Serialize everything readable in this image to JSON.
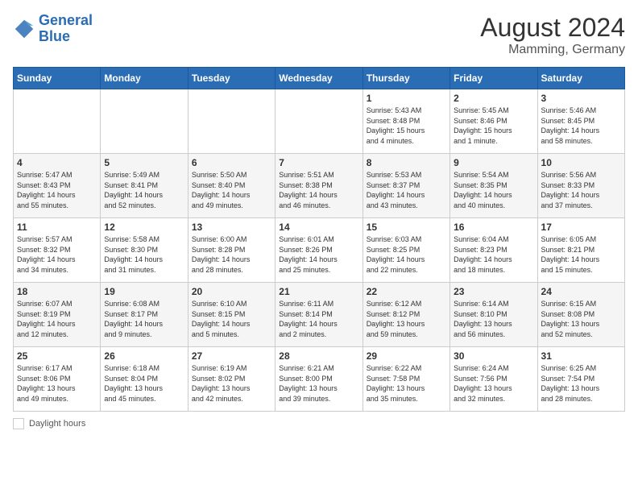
{
  "header": {
    "logo_line1": "General",
    "logo_line2": "Blue",
    "month_year": "August 2024",
    "location": "Mamming, Germany"
  },
  "weekdays": [
    "Sunday",
    "Monday",
    "Tuesday",
    "Wednesday",
    "Thursday",
    "Friday",
    "Saturday"
  ],
  "weeks": [
    [
      {
        "day": "",
        "info": ""
      },
      {
        "day": "",
        "info": ""
      },
      {
        "day": "",
        "info": ""
      },
      {
        "day": "",
        "info": ""
      },
      {
        "day": "1",
        "info": "Sunrise: 5:43 AM\nSunset: 8:48 PM\nDaylight: 15 hours\nand 4 minutes."
      },
      {
        "day": "2",
        "info": "Sunrise: 5:45 AM\nSunset: 8:46 PM\nDaylight: 15 hours\nand 1 minute."
      },
      {
        "day": "3",
        "info": "Sunrise: 5:46 AM\nSunset: 8:45 PM\nDaylight: 14 hours\nand 58 minutes."
      }
    ],
    [
      {
        "day": "4",
        "info": "Sunrise: 5:47 AM\nSunset: 8:43 PM\nDaylight: 14 hours\nand 55 minutes."
      },
      {
        "day": "5",
        "info": "Sunrise: 5:49 AM\nSunset: 8:41 PM\nDaylight: 14 hours\nand 52 minutes."
      },
      {
        "day": "6",
        "info": "Sunrise: 5:50 AM\nSunset: 8:40 PM\nDaylight: 14 hours\nand 49 minutes."
      },
      {
        "day": "7",
        "info": "Sunrise: 5:51 AM\nSunset: 8:38 PM\nDaylight: 14 hours\nand 46 minutes."
      },
      {
        "day": "8",
        "info": "Sunrise: 5:53 AM\nSunset: 8:37 PM\nDaylight: 14 hours\nand 43 minutes."
      },
      {
        "day": "9",
        "info": "Sunrise: 5:54 AM\nSunset: 8:35 PM\nDaylight: 14 hours\nand 40 minutes."
      },
      {
        "day": "10",
        "info": "Sunrise: 5:56 AM\nSunset: 8:33 PM\nDaylight: 14 hours\nand 37 minutes."
      }
    ],
    [
      {
        "day": "11",
        "info": "Sunrise: 5:57 AM\nSunset: 8:32 PM\nDaylight: 14 hours\nand 34 minutes."
      },
      {
        "day": "12",
        "info": "Sunrise: 5:58 AM\nSunset: 8:30 PM\nDaylight: 14 hours\nand 31 minutes."
      },
      {
        "day": "13",
        "info": "Sunrise: 6:00 AM\nSunset: 8:28 PM\nDaylight: 14 hours\nand 28 minutes."
      },
      {
        "day": "14",
        "info": "Sunrise: 6:01 AM\nSunset: 8:26 PM\nDaylight: 14 hours\nand 25 minutes."
      },
      {
        "day": "15",
        "info": "Sunrise: 6:03 AM\nSunset: 8:25 PM\nDaylight: 14 hours\nand 22 minutes."
      },
      {
        "day": "16",
        "info": "Sunrise: 6:04 AM\nSunset: 8:23 PM\nDaylight: 14 hours\nand 18 minutes."
      },
      {
        "day": "17",
        "info": "Sunrise: 6:05 AM\nSunset: 8:21 PM\nDaylight: 14 hours\nand 15 minutes."
      }
    ],
    [
      {
        "day": "18",
        "info": "Sunrise: 6:07 AM\nSunset: 8:19 PM\nDaylight: 14 hours\nand 12 minutes."
      },
      {
        "day": "19",
        "info": "Sunrise: 6:08 AM\nSunset: 8:17 PM\nDaylight: 14 hours\nand 9 minutes."
      },
      {
        "day": "20",
        "info": "Sunrise: 6:10 AM\nSunset: 8:15 PM\nDaylight: 14 hours\nand 5 minutes."
      },
      {
        "day": "21",
        "info": "Sunrise: 6:11 AM\nSunset: 8:14 PM\nDaylight: 14 hours\nand 2 minutes."
      },
      {
        "day": "22",
        "info": "Sunrise: 6:12 AM\nSunset: 8:12 PM\nDaylight: 13 hours\nand 59 minutes."
      },
      {
        "day": "23",
        "info": "Sunrise: 6:14 AM\nSunset: 8:10 PM\nDaylight: 13 hours\nand 56 minutes."
      },
      {
        "day": "24",
        "info": "Sunrise: 6:15 AM\nSunset: 8:08 PM\nDaylight: 13 hours\nand 52 minutes."
      }
    ],
    [
      {
        "day": "25",
        "info": "Sunrise: 6:17 AM\nSunset: 8:06 PM\nDaylight: 13 hours\nand 49 minutes."
      },
      {
        "day": "26",
        "info": "Sunrise: 6:18 AM\nSunset: 8:04 PM\nDaylight: 13 hours\nand 45 minutes."
      },
      {
        "day": "27",
        "info": "Sunrise: 6:19 AM\nSunset: 8:02 PM\nDaylight: 13 hours\nand 42 minutes."
      },
      {
        "day": "28",
        "info": "Sunrise: 6:21 AM\nSunset: 8:00 PM\nDaylight: 13 hours\nand 39 minutes."
      },
      {
        "day": "29",
        "info": "Sunrise: 6:22 AM\nSunset: 7:58 PM\nDaylight: 13 hours\nand 35 minutes."
      },
      {
        "day": "30",
        "info": "Sunrise: 6:24 AM\nSunset: 7:56 PM\nDaylight: 13 hours\nand 32 minutes."
      },
      {
        "day": "31",
        "info": "Sunrise: 6:25 AM\nSunset: 7:54 PM\nDaylight: 13 hours\nand 28 minutes."
      }
    ]
  ],
  "footer": {
    "daylight_label": "Daylight hours"
  }
}
